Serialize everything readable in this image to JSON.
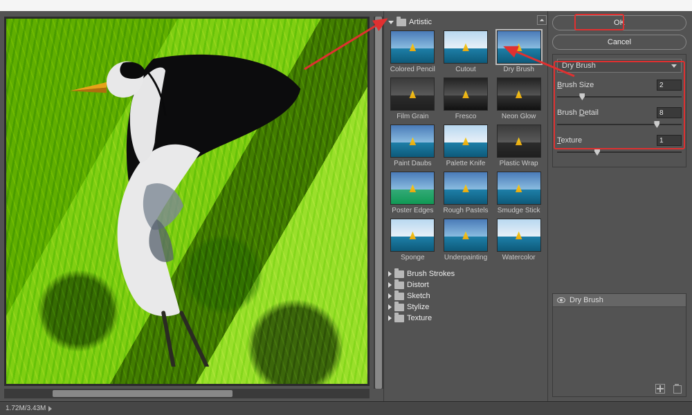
{
  "buttons": {
    "ok": "OK",
    "cancel": "Cancel"
  },
  "collapse_glyph": "⏶",
  "gallery": {
    "open_category": "Artistic",
    "filters": [
      {
        "label": "Colored Pencil"
      },
      {
        "label": "Cutout"
      },
      {
        "label": "Dry Brush",
        "selected": true
      },
      {
        "label": "Film Grain"
      },
      {
        "label": "Fresco"
      },
      {
        "label": "Neon Glow"
      },
      {
        "label": "Paint Daubs"
      },
      {
        "label": "Palette Knife"
      },
      {
        "label": "Plastic Wrap"
      },
      {
        "label": "Poster Edges"
      },
      {
        "label": "Rough Pastels"
      },
      {
        "label": "Smudge Stick"
      },
      {
        "label": "Sponge"
      },
      {
        "label": "Underpainting"
      },
      {
        "label": "Watercolor"
      }
    ],
    "closed_categories": [
      "Brush Strokes",
      "Distort",
      "Sketch",
      "Stylize",
      "Texture"
    ]
  },
  "settings": {
    "dropdown": "Dry Brush",
    "params": [
      {
        "label_pre": "",
        "hot": "B",
        "label_post": "rush Size",
        "value": "2",
        "pos": 18
      },
      {
        "label_pre": "Brush ",
        "hot": "D",
        "label_post": "etail",
        "value": "8",
        "pos": 78
      },
      {
        "label_pre": "",
        "hot": "T",
        "label_post": "exture",
        "value": "1",
        "pos": 30
      }
    ]
  },
  "layers": {
    "active": "Dry Brush"
  },
  "status": {
    "doc_size": "1.72M/3.43M"
  }
}
